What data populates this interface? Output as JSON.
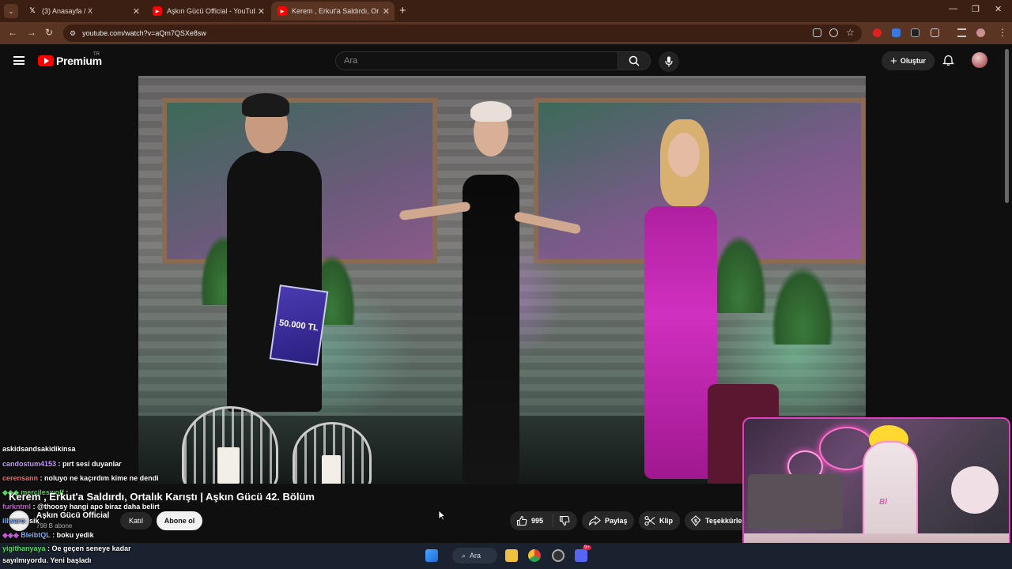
{
  "browser": {
    "tabs": [
      {
        "title": "(3) Anasayfa / X",
        "icon": "x-logo-icon",
        "active": false
      },
      {
        "title": "Aşkın Gücü Official - YouTube",
        "icon": "youtube-icon",
        "active": false
      },
      {
        "title": "Kerem , Erkut'a Saldırdı, Ortalık Karıştı",
        "icon": "youtube-icon",
        "active": true
      }
    ],
    "url": "youtube.com/watch?v=aQm7QSXe8sw"
  },
  "youtube": {
    "logo_text": "Premium",
    "region": "TR",
    "search_placeholder": "Ara",
    "create_label": "Oluştur"
  },
  "player": {
    "sign_text": "50.000 TL"
  },
  "chat": [
    {
      "user": "askidsandsakidikinsa",
      "message": ""
    },
    {
      "user": "candostum4153",
      "message": ": pırt sesi duyanlar"
    },
    {
      "user": "cerensann",
      "message": ": noluyo ne kaçırdım kime ne dendi"
    },
    {
      "user": "mercileswolf",
      "message": ":"
    },
    {
      "user": "furkntml",
      "message": ": @thoosy hangi apo biraz daha belirt"
    },
    {
      "user": "illwaro",
      "message": ": sik"
    },
    {
      "user": "BleibtQL",
      "message": ": boku yedik"
    },
    {
      "user": "yigithanyaya",
      "message": ": Oe geçen seneye kadar"
    },
    {
      "user": "",
      "message": "sayılmıyordu. Yeni başladı"
    }
  ],
  "video": {
    "title": "Kerem , Erkut'a Saldırdı, Ortalık Karıştı | Aşkın Gücü 42. Bölüm",
    "channel": "Aşkın Gücü Official",
    "subscribers": "798 B abone",
    "join_label": "Katıl",
    "subscribe_label": "Abone ol",
    "likes": "995",
    "share_label": "Paylaş",
    "clip_label": "Klip",
    "thanks_label": "Teşekkürler"
  },
  "taskbar": {
    "search_label": "Ara",
    "discord_badge": "9+"
  },
  "colors": {
    "tab_strip": "#3a1f12",
    "toolbar": "#5a3524",
    "youtube_red": "#ff0000",
    "webcam_border": "#e040c0"
  }
}
